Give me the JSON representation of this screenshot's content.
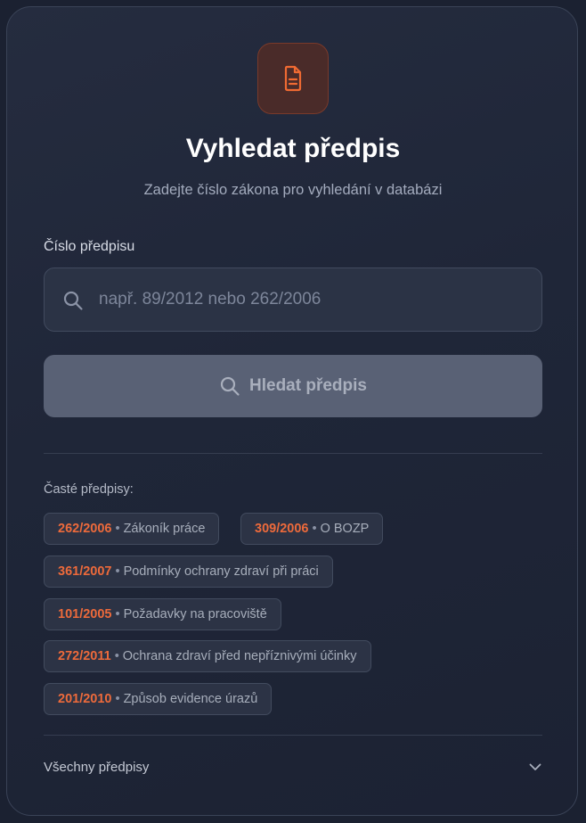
{
  "header": {
    "icon": "document-icon",
    "title": "Vyhledat předpis",
    "subtitle": "Zadejte číslo zákona pro vyhledání v databázi"
  },
  "search": {
    "label": "Číslo předpisu",
    "placeholder": "např. 89/2012 nebo 262/2006",
    "value": "",
    "icon": "search-icon"
  },
  "search_button": {
    "label": "Hledat předpis",
    "icon": "search-icon",
    "state": "disabled"
  },
  "frequent": {
    "label": "Časté předpisy:",
    "separator": "•",
    "items": [
      {
        "code": "262/2006",
        "desc": "Zákoník práce"
      },
      {
        "code": "309/2006",
        "desc": "O BOZP"
      },
      {
        "code": "361/2007",
        "desc": "Podmínky ochrany zdraví při práci"
      },
      {
        "code": "101/2005",
        "desc": "Požadavky na pracoviště"
      },
      {
        "code": "272/2011",
        "desc": "Ochrana zdraví před nepříznivými účinky"
      },
      {
        "code": "201/2010",
        "desc": "Způsob evidence úrazů"
      }
    ]
  },
  "all_regulations": {
    "label": "Všechny předpisy",
    "icon": "chevron-down-icon",
    "expanded": false
  },
  "colors": {
    "background": "#1b2131",
    "accent": "#ed6a3b",
    "button_disabled": "#596175"
  }
}
